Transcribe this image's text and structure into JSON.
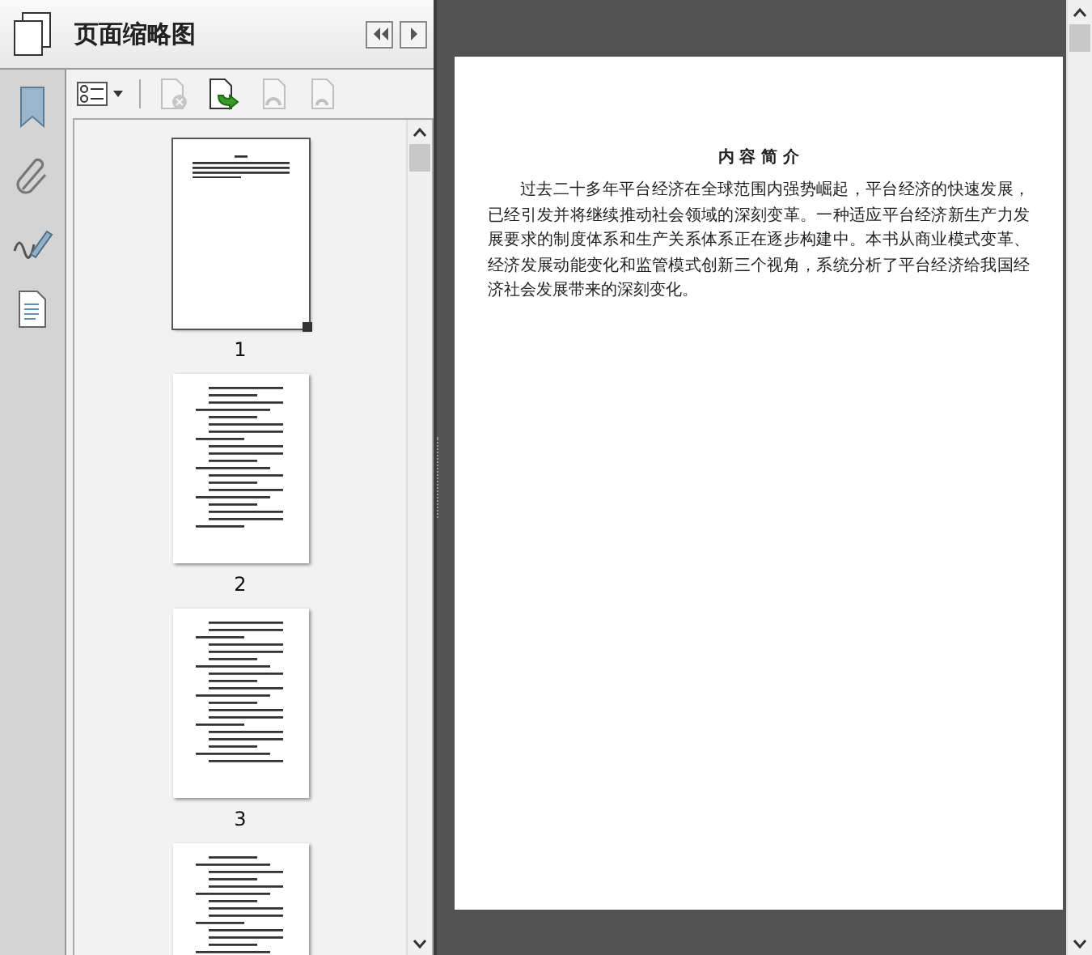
{
  "panel": {
    "title": "页面缩略图"
  },
  "toolbar": [
    {
      "kind": "options",
      "disabled": false
    },
    {
      "kind": "delete",
      "disabled": true
    },
    {
      "kind": "rotate",
      "disabled": false
    },
    {
      "kind": "copy",
      "disabled": true
    },
    {
      "kind": "paste",
      "disabled": true
    }
  ],
  "thumbnails": [
    {
      "label": "1",
      "selected": true
    },
    {
      "label": "2",
      "selected": false
    },
    {
      "label": "3",
      "selected": false
    },
    {
      "selected": false
    }
  ],
  "document": {
    "heading": "内 容 简 介",
    "paragraph": "过去二十多年平台经济在全球范围内强势崛起，平台经济的快速发展，已经引发并将继续推动社会领域的深刻变革。一种适应平台经济新生产力发展要求的制度体系和生产关系体系正在逐步构建中。本书从商业模式变革、经济发展动能变化和监管模式创新三个视角，系统分析了平台经济给我国经济社会发展带来的深刻变化。"
  }
}
